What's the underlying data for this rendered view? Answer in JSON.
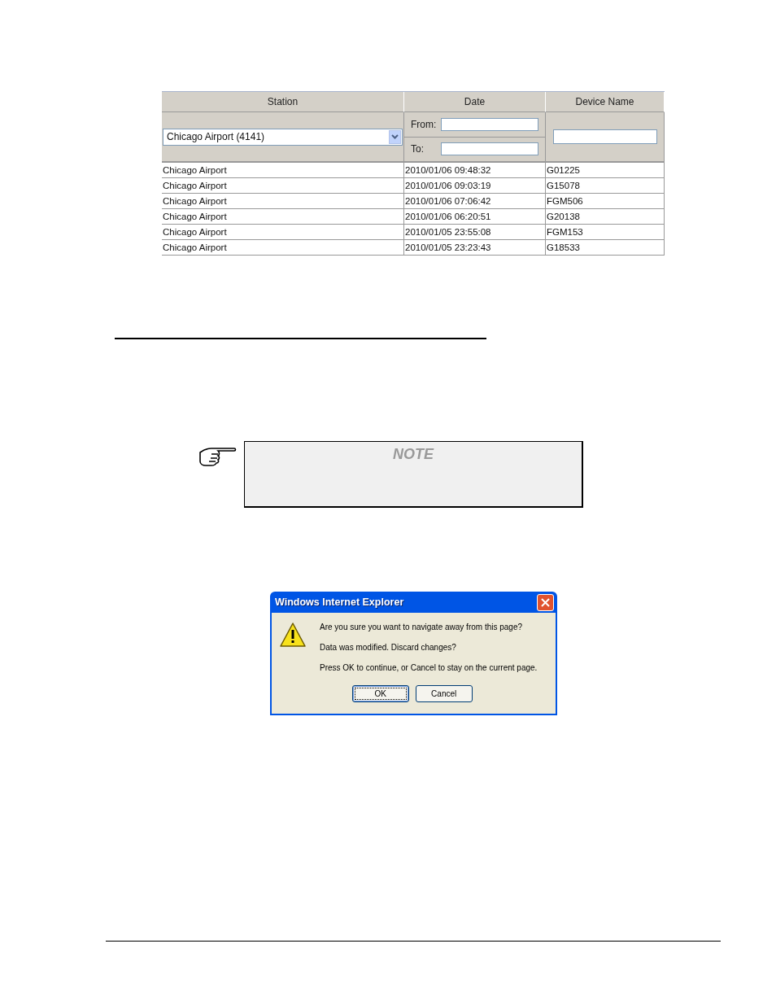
{
  "table": {
    "columns": [
      "Station",
      "Date",
      "Device Name"
    ],
    "filters": {
      "station": "Chicago Airport (4141)",
      "from_label": "From:",
      "to_label": "To:"
    },
    "rows": [
      [
        "Chicago Airport",
        "2010/01/06 09:48:32",
        "G01225"
      ],
      [
        "Chicago Airport",
        "2010/01/06 09:03:19",
        "G15078"
      ],
      [
        "Chicago Airport",
        "2010/01/06 07:06:42",
        "FGM506"
      ],
      [
        "Chicago Airport",
        "2010/01/06 06:20:51",
        "G20138"
      ],
      [
        "Chicago Airport",
        "2010/01/05 23:55:08",
        "FGM153"
      ],
      [
        "Chicago Airport",
        "2010/01/05 23:23:43",
        "G18533"
      ]
    ]
  },
  "note": {
    "title": "NOTE"
  },
  "dialog": {
    "title": "Windows Internet Explorer",
    "lines": [
      "Are you sure you want to navigate away from this page?",
      "Data was modified. Discard changes?",
      "Press OK to continue, or Cancel to stay on the current page."
    ],
    "buttons": [
      {
        "label": "OK",
        "selected": true
      },
      {
        "label": "Cancel",
        "selected": false
      }
    ]
  }
}
